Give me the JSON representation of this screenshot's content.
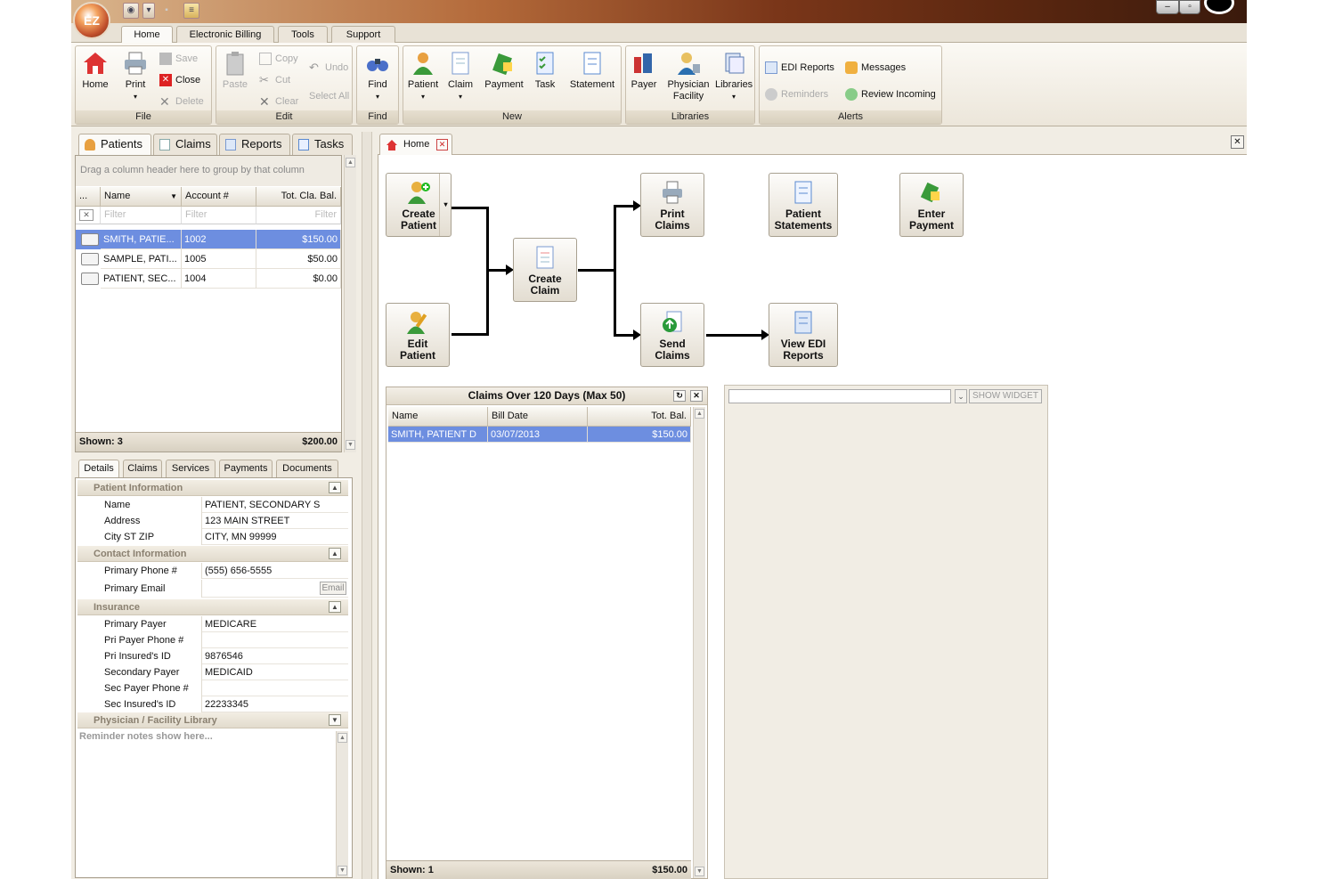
{
  "ribbon_tabs": [
    "Home",
    "Electronic Billing",
    "Tools",
    "Support"
  ],
  "ribbon": {
    "file": {
      "label": "File",
      "home": "Home",
      "print": "Print",
      "save": "Save",
      "close": "Close",
      "delete": "Delete"
    },
    "edit": {
      "label": "Edit",
      "paste": "Paste",
      "copy": "Copy",
      "cut": "Cut",
      "clear": "Clear",
      "undo": "Undo",
      "select_all": "Select All"
    },
    "find": {
      "label": "Find",
      "find": "Find"
    },
    "new": {
      "label": "New",
      "patient": "Patient",
      "claim": "Claim",
      "payment": "Payment",
      "task": "Task",
      "statement": "Statement"
    },
    "libraries": {
      "label": "Libraries",
      "payer": "Payer",
      "physician_l1": "Physician",
      "physician_l2": "Facility",
      "libraries": "Libraries"
    },
    "alerts": {
      "label": "Alerts",
      "edi_reports": "EDI Reports",
      "reminders": "Reminders",
      "messages": "Messages",
      "review_incoming": "Review Incoming"
    }
  },
  "left_tabs": [
    "Patients",
    "Claims",
    "Reports",
    "Tasks"
  ],
  "patients_grid": {
    "group_hint": "Drag a column header here to group by that column",
    "columns": [
      "...",
      "Name",
      "Account #",
      "Tot. Cla. Bal."
    ],
    "filter_placeholder": "Filter",
    "rows": [
      {
        "name": "SMITH, PATIE...",
        "account": "1002",
        "balance": "$150.00"
      },
      {
        "name": "SAMPLE, PATI...",
        "account": "1005",
        "balance": "$50.00"
      },
      {
        "name": "PATIENT, SEC...",
        "account": "1004",
        "balance": "$0.00"
      }
    ],
    "shown": "Shown: 3",
    "total": "$200.00"
  },
  "detail_tabs": [
    "Details",
    "Claims",
    "Services",
    "Payments",
    "Documents"
  ],
  "details": {
    "patient_info": {
      "header": "Patient Information",
      "name_label": "Name",
      "name": "PATIENT, SECONDARY S",
      "address_label": "Address",
      "address": "123 MAIN STREET",
      "city_label": "City ST ZIP",
      "city": "CITY, MN 99999"
    },
    "contact": {
      "header": "Contact Information",
      "phone_label": "Primary Phone #",
      "phone": "(555) 656-5555",
      "email_label": "Primary Email",
      "email_button": "Email"
    },
    "insurance": {
      "header": "Insurance",
      "primary_payer_label": "Primary Payer",
      "primary_payer": "MEDICARE",
      "pri_phone_label": "Pri Payer Phone #",
      "pri_insured_label": "Pri Insured's ID",
      "pri_insured": "9876546",
      "secondary_payer_label": "Secondary Payer",
      "secondary_payer": "MEDICAID",
      "sec_phone_label": "Sec Payer Phone #",
      "sec_insured_label": "Sec Insured's ID",
      "sec_insured": "22233345"
    },
    "physician": {
      "header": "Physician / Facility Library"
    },
    "reminder_placeholder": "Reminder notes show here..."
  },
  "doc_tab": "Home",
  "workflow": {
    "create_patient": [
      "Create",
      "Patient"
    ],
    "edit_patient": [
      "Edit",
      "Patient"
    ],
    "create_claim": [
      "Create",
      "Claim"
    ],
    "print_claims": [
      "Print",
      "Claims"
    ],
    "send_claims": [
      "Send",
      "Claims"
    ],
    "patient_statements": [
      "Patient",
      "Statements"
    ],
    "view_edi": [
      "View EDI",
      "Reports"
    ],
    "enter_payment": [
      "Enter",
      "Payment"
    ]
  },
  "claims_panel": {
    "title": "Claims Over 120 Days (Max 50)",
    "columns": [
      "Name",
      "Bill Date",
      "Tot. Bal."
    ],
    "rows": [
      {
        "name": "SMITH, PATIENT D",
        "bill_date": "03/07/2013",
        "balance": "$150.00"
      }
    ],
    "shown": "Shown: 1",
    "total": "$150.00"
  },
  "widget": {
    "button": "SHOW WIDGET"
  },
  "colors": {
    "selection": "#6d8ee0",
    "ribbon_bg": "#f1ede4",
    "title_gradient_end": "#3a1a0c"
  }
}
